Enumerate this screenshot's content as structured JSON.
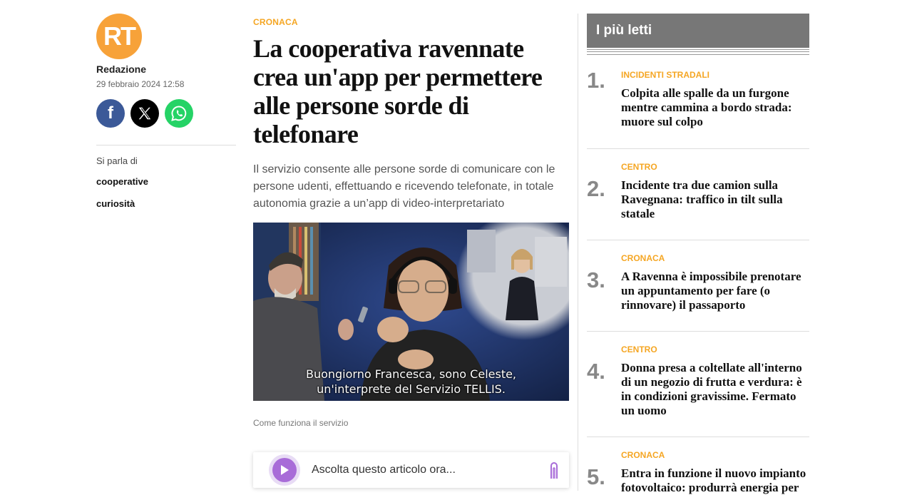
{
  "logo": {
    "text": "RT",
    "color": "#f7a239"
  },
  "author": "Redazione",
  "date": "29 febbraio 2024 12:58",
  "social": [
    "facebook-icon",
    "x-icon",
    "whatsapp-icon"
  ],
  "topics": {
    "label": "Si parla di",
    "items": [
      "cooperative",
      "curiosità"
    ]
  },
  "article": {
    "kicker": "CRONACA",
    "title": "La cooperativa ravennate crea un'app per permettere alle persone sorde di telefonare",
    "lead": "Il servizio consente alle persone sorde di comunicare con le persone udenti, effettuando e ricevendo telefonate, in totale autonomia grazie a un’app di video-interpretariato",
    "video_subtitle_1": "Buongiorno Francesca, sono Celeste,",
    "video_subtitle_2": "un'interprete del Servizio TELLIS.",
    "caption": "Come funziona il servizio"
  },
  "player": {
    "label": "Ascolta questo articolo ora...",
    "accent": "#a86cd8"
  },
  "most_read": {
    "header": "I più letti",
    "items": [
      {
        "num": "1.",
        "kicker": "INCIDENTI STRADALI",
        "title": "Colpita alle spalle da un furgone mentre cammina a bordo strada: muore sul colpo"
      },
      {
        "num": "2.",
        "kicker": "CENTRO",
        "title": "Incidente tra due camion sulla Ravegnana: traffico in tilt sulla statale"
      },
      {
        "num": "3.",
        "kicker": "CRONACA",
        "title": "A Ravenna è impossibile prenotare un appuntamento per fare (o rinnovare) il passaporto"
      },
      {
        "num": "4.",
        "kicker": "CENTRO",
        "title": "Donna presa a coltellate all'interno di un negozio di frutta e verdura: è in condizioni gravissime. Fermato un uomo"
      },
      {
        "num": "5.",
        "kicker": "CRONACA",
        "title": "Entra in funzione il nuovo impianto fotovoltaico: produrrà energia per"
      }
    ]
  },
  "colors": {
    "accent": "#f5a623",
    "header_bg": "#777777"
  }
}
